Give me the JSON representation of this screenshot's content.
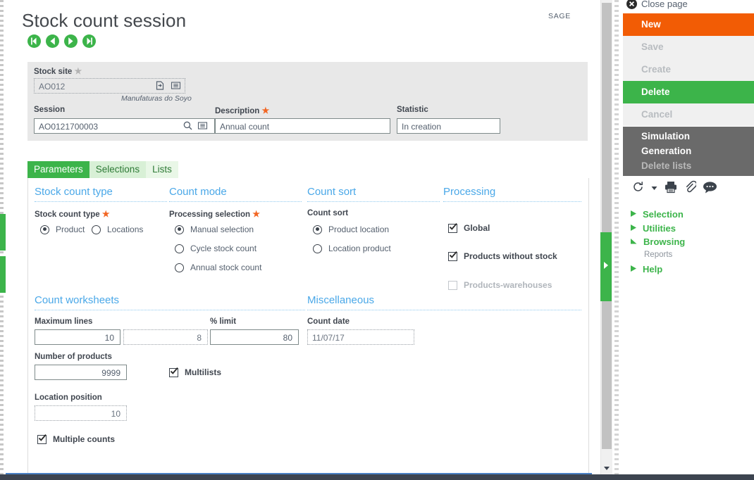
{
  "page": {
    "title": "Stock count session",
    "brand": "SAGE",
    "nav": [
      {
        "name": "first-record",
        "icon": "first-arrow-icon"
      },
      {
        "name": "previous-record",
        "icon": "previous-arrow-icon"
      },
      {
        "name": "next-record",
        "icon": "next-arrow-icon"
      },
      {
        "name": "last-record",
        "icon": "last-arrow-icon"
      }
    ]
  },
  "header_fields": {
    "stock_site": {
      "label": "Stock site",
      "required_marker": "★",
      "value": "AO012",
      "note": "Manufaturas do Soyo",
      "icon_a": "jump-to-icon",
      "icon_b": "lookup-list-icon"
    },
    "session": {
      "label": "Session",
      "value": "AO0121700003",
      "icon_a": "search-icon",
      "icon_b": "lookup-list-icon"
    },
    "description": {
      "label": "Description",
      "required_marker": "★",
      "value": "Annual count"
    },
    "statistic": {
      "label": "Statistic",
      "value": "In creation"
    }
  },
  "tabs": [
    {
      "label": "Parameters",
      "state": "active"
    },
    {
      "label": "Selections",
      "state": "inactive"
    },
    {
      "label": "Lists",
      "state": "plain"
    }
  ],
  "sections": {
    "stock_count_type": {
      "title": "Stock count type",
      "field_label": "Stock count type",
      "required_marker": "★",
      "options": [
        {
          "label": "Product",
          "selected": true
        },
        {
          "label": "Locations",
          "selected": false
        }
      ]
    },
    "count_mode": {
      "title": "Count mode",
      "field_label": "Processing selection",
      "required_marker": "★",
      "options": [
        {
          "label": "Manual selection",
          "selected": true
        },
        {
          "label": "Cycle stock count",
          "selected": false
        },
        {
          "label": "Annual stock count",
          "selected": false
        }
      ]
    },
    "count_sort": {
      "title": "Count sort",
      "field_label": "Count sort",
      "options": [
        {
          "label": "Product location",
          "selected": true
        },
        {
          "label": "Location product",
          "selected": false
        }
      ]
    },
    "processing": {
      "title": "Processing",
      "checkboxes": [
        {
          "label": "Global",
          "checked": true,
          "disabled": false
        },
        {
          "label": "Products without stock",
          "checked": true,
          "disabled": false
        },
        {
          "label": "Products-warehouses",
          "checked": false,
          "disabled": true
        }
      ]
    },
    "count_worksheets": {
      "title": "Count worksheets",
      "maximum_lines_label": "Maximum lines",
      "maximum_lines_value": "10",
      "maximum_lines_second_value": "8",
      "percent_limit_label": "% limit",
      "percent_limit_value": "80",
      "number_of_products_label": "Number of products",
      "number_of_products_value": "9999",
      "location_position_label": "Location position",
      "location_position_value": "10",
      "multilists_label": "Multilists",
      "multilists_checked": true,
      "multiple_counts_label": "Multiple counts",
      "multiple_counts_checked": true
    },
    "miscellaneous": {
      "title": "Miscellaneous",
      "count_date_label": "Count date",
      "count_date_value": "11/07/17"
    }
  },
  "right_panel": {
    "close_page": "Close page",
    "actions": [
      {
        "label": "New",
        "style": "new"
      },
      {
        "label": "Save",
        "style": "disabled"
      },
      {
        "label": "Create",
        "style": "disabled"
      },
      {
        "label": "Delete",
        "style": "delete"
      },
      {
        "label": "Cancel",
        "style": "disabled"
      }
    ],
    "group_actions": [
      {
        "label": "Simulation",
        "disabled": false
      },
      {
        "label": "Generation",
        "disabled": false
      },
      {
        "label": "Delete lists",
        "disabled": true
      }
    ],
    "tools": [
      {
        "name": "refresh-icon"
      },
      {
        "name": "chevron-down-icon"
      },
      {
        "name": "print-icon"
      },
      {
        "name": "attachment-icon"
      },
      {
        "name": "comment-icon"
      }
    ],
    "menu": [
      {
        "label": "Selection",
        "expanded": false
      },
      {
        "label": "Utilities",
        "expanded": false
      },
      {
        "label": "Browsing",
        "expanded": true
      },
      {
        "label": "Help",
        "expanded": false
      }
    ],
    "browsing_child": "Reports"
  },
  "colors": {
    "brand_green": "#3cb44a",
    "accent_orange": "#f25c05",
    "section_blue": "#4aa8e8",
    "required_orange": "#f26522",
    "group_grey": "#6a6a6a"
  }
}
